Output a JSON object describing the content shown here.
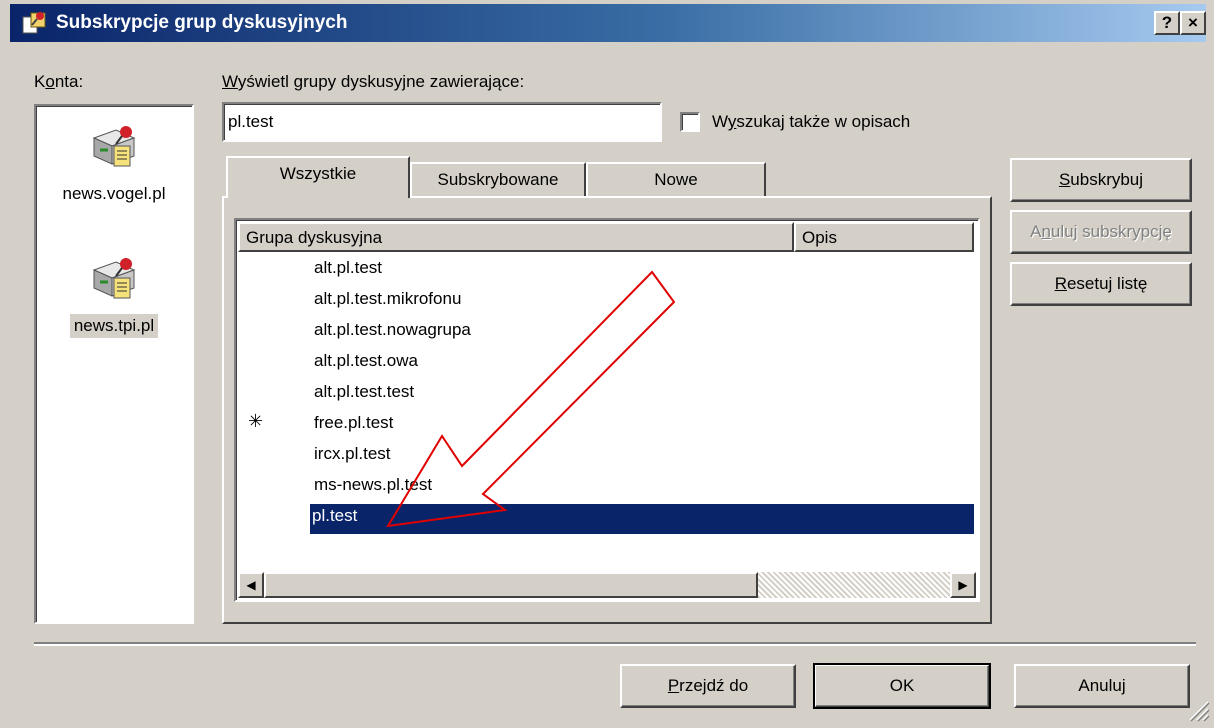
{
  "window": {
    "title": "Subskrypcje grup dyskusyjnych",
    "help_button": "?",
    "close_button": "×"
  },
  "accounts": {
    "label_accel": "o",
    "label_pre": "K",
    "label_post": "nta:",
    "items": [
      {
        "name": "news.vogel.pl",
        "selected": false
      },
      {
        "name": "news.tpi.pl",
        "selected": true
      }
    ]
  },
  "search": {
    "label_pre": "W",
    "label_accel": "y",
    "label_post": "świetl grupy dyskusyjne zawierające:",
    "value": "pl.test",
    "description_check_pre": "W",
    "description_check_accel": "y",
    "description_check_post": "szukaj także w opisach",
    "description_checked": false
  },
  "tabs": [
    {
      "label": "Wszystkie",
      "active": true
    },
    {
      "label": "Subskrybowane",
      "active": false
    },
    {
      "label": "Nowe",
      "active": false
    }
  ],
  "list": {
    "columns": [
      "Grupa dyskusyjna",
      "Opis"
    ],
    "rows": [
      {
        "name": "alt.pl.test",
        "new": false,
        "selected": false
      },
      {
        "name": "alt.pl.test.mikrofonu",
        "new": false,
        "selected": false
      },
      {
        "name": "alt.pl.test.nowagrupa",
        "new": false,
        "selected": false
      },
      {
        "name": "alt.pl.test.owa",
        "new": false,
        "selected": false
      },
      {
        "name": "alt.pl.test.test",
        "new": false,
        "selected": false
      },
      {
        "name": "free.pl.test",
        "new": true,
        "selected": false
      },
      {
        "name": "ircx.pl.test",
        "new": false,
        "selected": false
      },
      {
        "name": "ms-news.pl.test",
        "new": false,
        "selected": false
      },
      {
        "name": "pl.test",
        "new": false,
        "selected": true
      }
    ],
    "new_marker": "✳"
  },
  "side_buttons": {
    "subscribe_accel": "S",
    "subscribe_rest": "ubskrybuj",
    "unsubscribe_pre": "A",
    "unsubscribe_accel": "n",
    "unsubscribe_rest": "uluj subskrypcję",
    "reset_accel": "R",
    "reset_rest": "esetuj listę"
  },
  "bottom_buttons": {
    "goto_accel": "P",
    "goto_rest": "rzejdź do",
    "ok": "OK",
    "cancel": "Anuluj"
  },
  "colors": {
    "selection": "#0a246a",
    "face": "#d4d0c8",
    "annotation_arrow": "#e00000"
  }
}
